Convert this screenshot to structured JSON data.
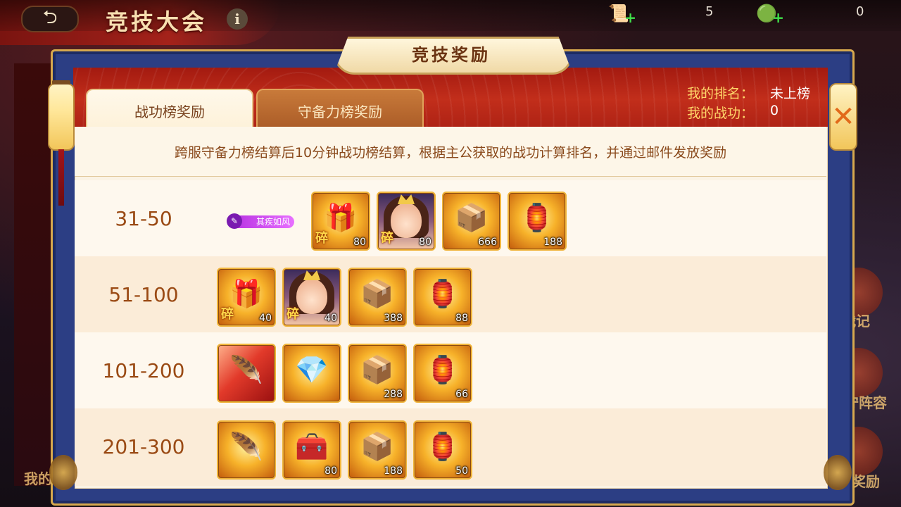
{
  "game": {
    "title": "竞技大会",
    "back_icon": "back-arrow-icon"
  },
  "resources": [
    {
      "icon": "scroll-icon",
      "glyph": "📜",
      "count": "5"
    },
    {
      "icon": "jade-icon",
      "glyph": "🟢",
      "count": "0"
    }
  ],
  "modal": {
    "title": "竞技奖励",
    "close_glyph": "✕",
    "tabs": [
      {
        "label": "战功榜奖励",
        "active": true
      },
      {
        "label": "守备力榜奖励",
        "active": false
      }
    ],
    "my_rank_label": "我的排名：",
    "my_rank_value": "未上榜",
    "my_power_label": "我的战功：",
    "my_power_value": "0",
    "notice": "跨服守备力榜结算后10分钟战功榜结算，根据主公获取的战功计算排名，并通过邮件发放奖励"
  },
  "rewards": [
    {
      "range": "31-50",
      "title_badge": "其疾如风",
      "items": [
        {
          "name": "equipment-shard",
          "glyph": "🎁",
          "count": "80",
          "shard": "碎",
          "style": "gold"
        },
        {
          "name": "hero-shard",
          "count": "80",
          "shard": "碎",
          "style": "hero"
        },
        {
          "name": "treasure-chest",
          "glyph": "📦",
          "count": "666",
          "style": "gold"
        },
        {
          "name": "lucky-token",
          "glyph": "🏮",
          "count": "188",
          "style": "gold"
        }
      ]
    },
    {
      "range": "51-100",
      "items": [
        {
          "name": "equipment-shard",
          "glyph": "🎁",
          "count": "40",
          "shard": "碎",
          "style": "gold"
        },
        {
          "name": "hero-shard",
          "count": "40",
          "shard": "碎",
          "style": "hero"
        },
        {
          "name": "treasure-chest",
          "glyph": "📦",
          "count": "388",
          "style": "gold"
        },
        {
          "name": "lucky-token",
          "glyph": "🏮",
          "count": "88",
          "style": "gold"
        }
      ]
    },
    {
      "range": "101-200",
      "items": [
        {
          "name": "flame-feather",
          "glyph": "🪶",
          "count": "",
          "style": "red"
        },
        {
          "name": "golden-chest",
          "glyph": "💎",
          "count": "",
          "style": "gold"
        },
        {
          "name": "treasure-chest",
          "glyph": "📦",
          "count": "288",
          "style": "gold"
        },
        {
          "name": "lucky-token",
          "glyph": "🏮",
          "count": "66",
          "style": "gold"
        }
      ]
    },
    {
      "range": "201-300",
      "items": [
        {
          "name": "red-feather",
          "glyph": "🪶",
          "count": "",
          "style": "gold"
        },
        {
          "name": "golden-chest",
          "glyph": "🧰",
          "count": "80",
          "style": "gold"
        },
        {
          "name": "treasure-chest",
          "glyph": "📦",
          "count": "188",
          "style": "gold"
        },
        {
          "name": "lucky-token",
          "glyph": "🏮",
          "count": "50",
          "style": "gold"
        }
      ]
    }
  ],
  "side_labels": {
    "right_1": "战记",
    "right_2": "守阵容",
    "right_3": "奖励",
    "left_1": "我的"
  }
}
